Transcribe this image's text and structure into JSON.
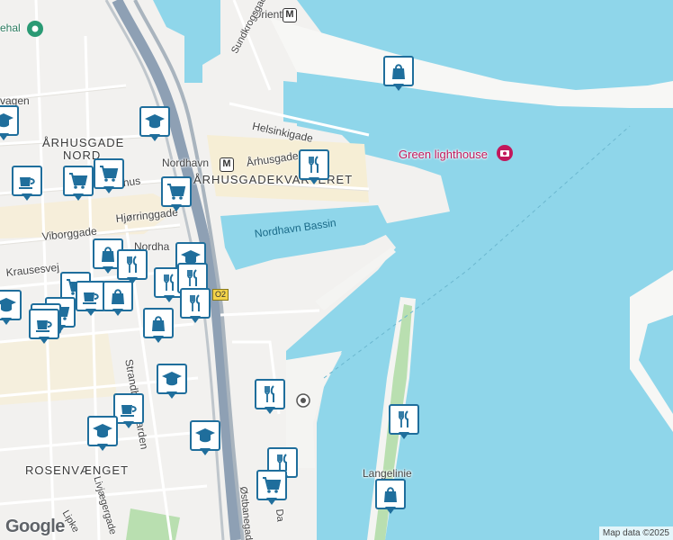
{
  "labels": {
    "orientkaj": "Orientkaj",
    "sundkrogsgade": "Sundkrogsgade",
    "helsinkigade": "Helsinkigade",
    "green_lighthouse": "Green lighthouse",
    "aarhusgade": "Århusgade",
    "aarhusgadekvarteret": "ÅRHUSGADEKVARTERET",
    "aarhusgade_nord_1": "ÅRHUSGADE",
    "aarhusgade_nord_2": "NORD",
    "nordhavn_1": "Nordhavn",
    "nordhavn_2": "Nordha",
    "nordhavn_bassin": "Nordhavn Bassin",
    "viborggade": "Viborggade",
    "hjorringgade": "Hjørringgade",
    "krausesvej": "Krausesvej",
    "strandboulevarden": "Strandboulevarden",
    "rosenvaenget": "ROSENVÆNGET",
    "livjaegergade": "Livjægergade",
    "ostbanegade": "Østbanegade",
    "langelinie": "Langelinie",
    "vagen": "vagen",
    "ehal": "ehal",
    "aarhusgade_stub": "Århus",
    "da_stub": "Da",
    "lipk_stub": "Lipke",
    "road_number": "O2"
  },
  "metro_symbol": "M",
  "icons": {
    "shopping": "shopping-bag-icon",
    "restaurant": "restaurant-icon",
    "cafe": "cafe-icon",
    "grocery": "shopping-cart-icon",
    "school": "school-icon",
    "camera": "camera-icon",
    "metro": "metro-icon"
  },
  "colors": {
    "water": "#8fd6ea",
    "park": "#b9dfb0",
    "pin_border": "#1f6e9c",
    "poi_text": "#c2185b",
    "highway": "#8ea0b4",
    "built_area": "#f6eed5"
  },
  "attribution": {
    "logo": "Google",
    "map_data": "Map data ©2025"
  }
}
